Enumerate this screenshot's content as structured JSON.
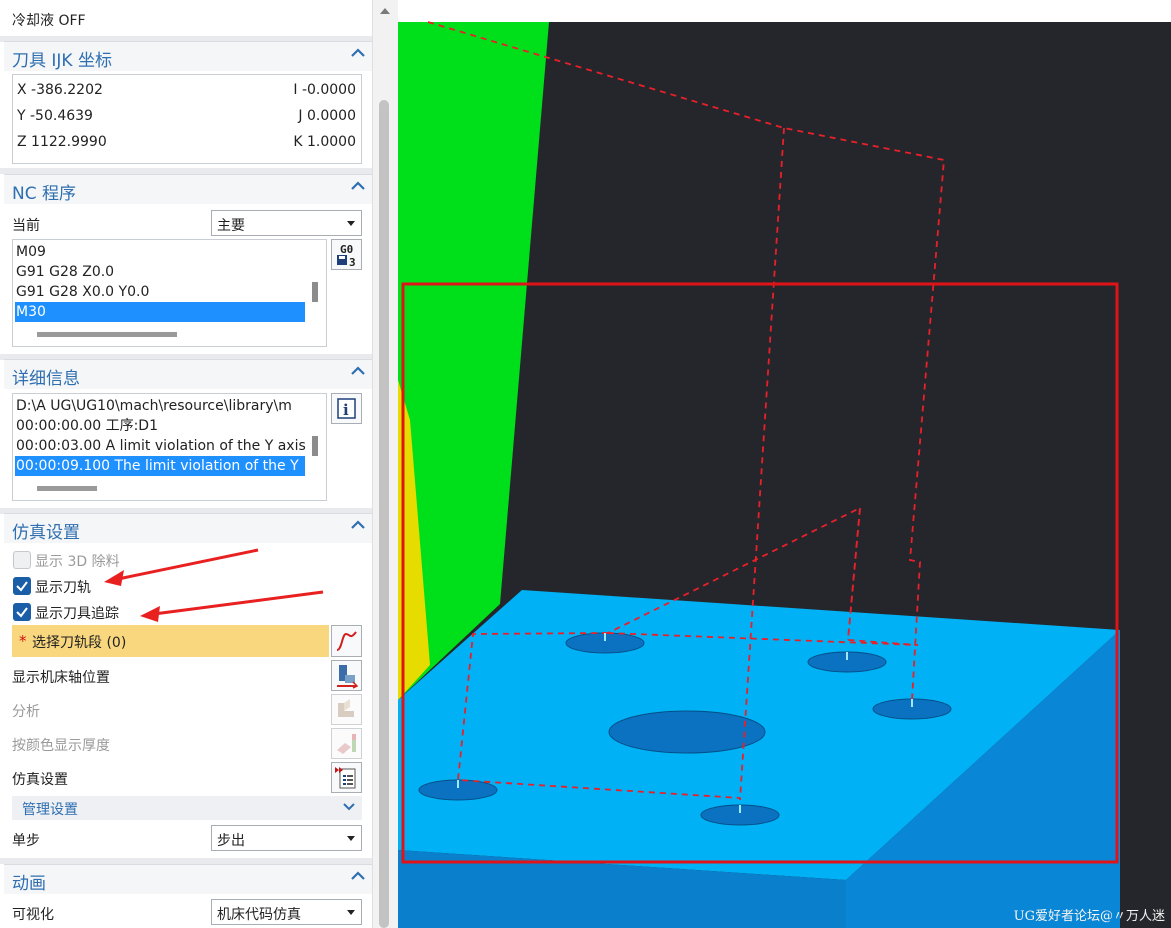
{
  "coolant": {
    "label": "冷却液 OFF"
  },
  "tool_ijk": {
    "title": "刀具 IJK 坐标",
    "x": "X -386.2202",
    "y": "Y -50.4639",
    "z": "Z 1122.9990",
    "i": "I -0.0000",
    "j": "J 0.0000",
    "k": "K 1.0000"
  },
  "nc_program": {
    "title": "NC 程序",
    "current_label": "当前",
    "current_value": "主要",
    "lines": [
      "M09",
      "G91 G28 Z0.0",
      "G91 G28 X0.0 Y0.0",
      "M30"
    ],
    "selected_index": 3,
    "gcode_icon_text": "G0\n3"
  },
  "details": {
    "title": "详细信息",
    "lines": [
      "D:\\A UG\\UG10\\mach\\resource\\library\\m",
      "00:00:00.00 工序:D1",
      "00:00:03.00 A limit violation of the Y axis",
      "00:00:09.100 The limit violation of the Y"
    ],
    "selected_index": 3
  },
  "sim_settings": {
    "title": "仿真设置",
    "show_3d_removal": "显示 3D 除料",
    "show_3d_removal_checked": false,
    "show_toolpath": "显示刀轨",
    "show_toolpath_checked": true,
    "show_tool_trace": "显示刀具追踪",
    "show_tool_trace_checked": true,
    "select_segment": "选择刀轨段 (0)",
    "required_mark": "*",
    "show_axis_pos": "显示机床轴位置",
    "analysis": "分析",
    "thickness_by_color": "按颜色显示厚度",
    "sim_settings_row": "仿真设置",
    "manage_settings": "管理设置",
    "step_label": "单步",
    "step_value": "步出"
  },
  "animation": {
    "title": "动画",
    "visualize_label": "可视化",
    "visualize_value": "机床代码仿真"
  },
  "watermark": "UG爱好者论坛@〃万人迷",
  "colors": {
    "accent": "#2f6fb0",
    "selection": "#1e90ff",
    "highlight_row": "#f9d77e",
    "part_top": "#00b2f5",
    "part_side": "#0a86d6",
    "fixture_green": "#00e01a",
    "fixture_yellow": "#e6dc00",
    "background": "#25262b",
    "toolpath": "#e8202a"
  }
}
